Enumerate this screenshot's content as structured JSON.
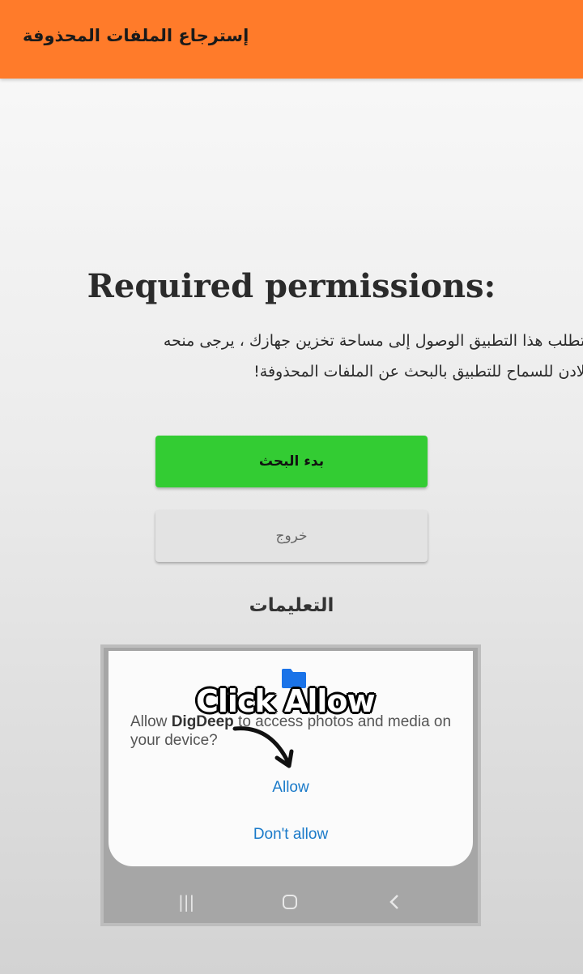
{
  "appbar": {
    "title": "إسترجاع الملفات المحذوفة"
  },
  "permissions": {
    "title": "Required permissions:",
    "line1": "يتطلب هذا التطبيق الوصول إلى مساحة تخزين جهازك ، يرجى منحه",
    "line2": "الادن للسماح للتطبيق بالبحث عن الملفات المحذوفة!"
  },
  "buttons": {
    "start": "بدء البحث",
    "exit": "خروج"
  },
  "instructions": {
    "title": "التعليمات",
    "image": {
      "overlay": "Click Allow",
      "prompt_prefix": "Allow ",
      "app_name": "DigDeep",
      "prompt_suffix": " to access photos and media on your device?",
      "allow": "Allow",
      "deny": "Don't allow",
      "folder_color": "#1a73e8"
    }
  },
  "colors": {
    "appbar": "#ff7b2a",
    "start_button": "#33cc33",
    "exit_button": "#e3e3e3"
  }
}
